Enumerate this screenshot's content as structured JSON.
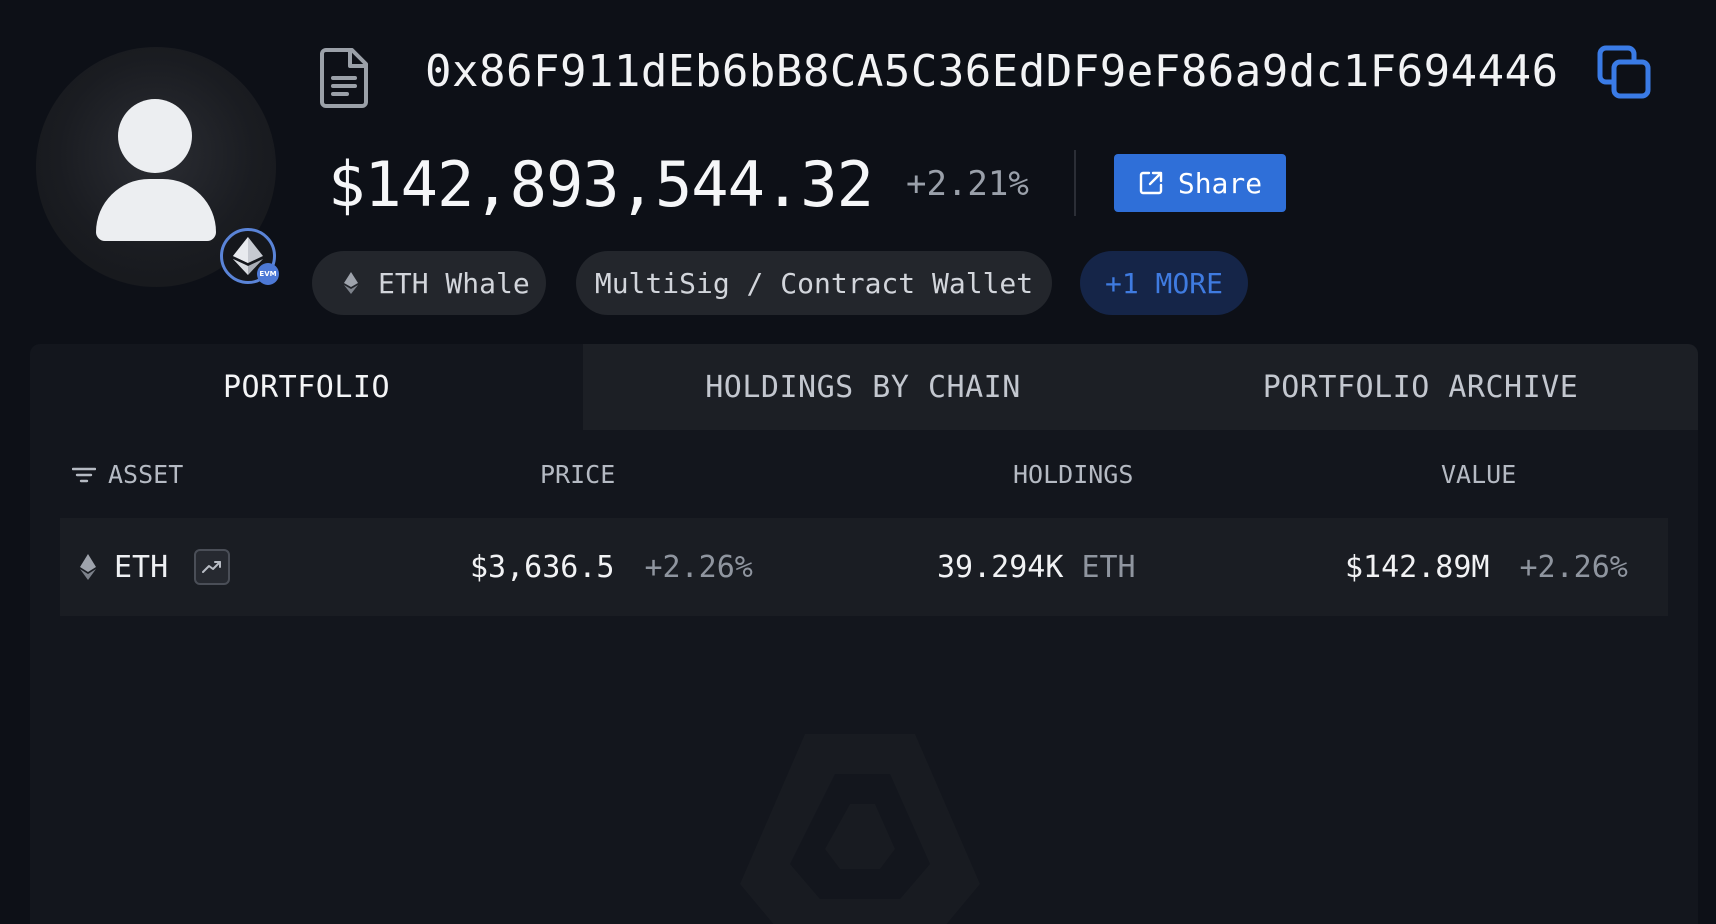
{
  "profile": {
    "address": "0x86F911dEb6bB8CA5C36EdDF9eF86a9dc1F694446",
    "chain_badge": "EVM",
    "balance": "$142,893,544.32",
    "balance_change": "+2.21%",
    "share_label": "Share"
  },
  "tags": [
    {
      "label": "ETH Whale",
      "icon": "eth-icon"
    },
    {
      "label": "MultiSig / Contract Wallet"
    },
    {
      "label": "+1 MORE"
    }
  ],
  "tabs": [
    {
      "label": "PORTFOLIO",
      "active": true
    },
    {
      "label": "HOLDINGS BY CHAIN",
      "active": false
    },
    {
      "label": "PORTFOLIO ARCHIVE",
      "active": false
    }
  ],
  "table": {
    "headers": {
      "asset": "ASSET",
      "price": "PRICE",
      "holdings": "HOLDINGS",
      "value": "VALUE"
    },
    "rows": [
      {
        "asset": "ETH",
        "price": "$3,636.5",
        "price_change": "+2.26%",
        "holdings": "39.294K",
        "holdings_unit": "ETH",
        "value": "$142.89M",
        "value_change": "+2.26%"
      }
    ]
  },
  "colors": {
    "background": "#0d1017",
    "panel": "#13161d",
    "accent": "#2f6fd8",
    "more_tag_text": "#3f7be0"
  }
}
